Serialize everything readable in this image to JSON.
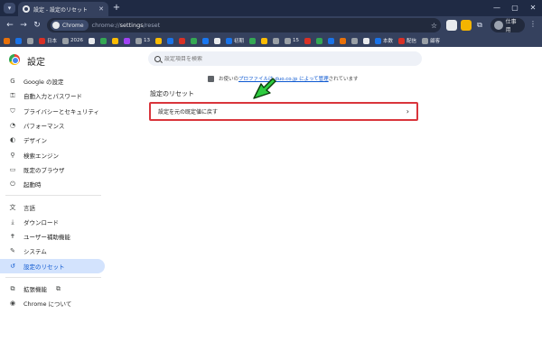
{
  "browser": {
    "tab_title": "設定 - 設定のリセット",
    "tab_close": "✕",
    "new_tab": "+",
    "omnibox": {
      "chip": "Chrome",
      "url_scheme": "chrome://",
      "url_path": "settings",
      "url_rest": "/reset"
    },
    "profile_label": "仕事用",
    "bookmarks": [
      {
        "label": "",
        "color": "#e8710a"
      },
      {
        "label": "",
        "color": "#1a73e8"
      },
      {
        "label": "",
        "color": "#9aa0a6"
      },
      {
        "label": "日本",
        "color": "#d93025"
      },
      {
        "label": "2026",
        "color": "#9aa0a6"
      },
      {
        "label": "",
        "color": "#e8eaed"
      },
      {
        "label": "",
        "color": "#34a853"
      },
      {
        "label": "",
        "color": "#fbbc04"
      },
      {
        "label": "",
        "color": "#a142f4"
      },
      {
        "label": "13",
        "color": "#9aa0a6"
      },
      {
        "label": "",
        "color": "#fbbc04"
      },
      {
        "label": "",
        "color": "#1a73e8"
      },
      {
        "label": "",
        "color": "#d93025"
      },
      {
        "label": "",
        "color": "#34a853"
      },
      {
        "label": "",
        "color": "#1877f2"
      },
      {
        "label": "",
        "color": "#e8eaed"
      },
      {
        "label": "初期",
        "color": "#1a73e8"
      },
      {
        "label": "",
        "color": "#34a853"
      },
      {
        "label": "",
        "color": "#fbbc04"
      },
      {
        "label": "",
        "color": "#9aa0a6"
      },
      {
        "label": "15",
        "color": "#9aa0a6"
      },
      {
        "label": "",
        "color": "#d93025"
      },
      {
        "label": "",
        "color": "#34a853"
      },
      {
        "label": "",
        "color": "#1a73e8"
      },
      {
        "label": "",
        "color": "#e8710a"
      },
      {
        "label": "",
        "color": "#9aa0a6"
      },
      {
        "label": "",
        "color": "#e8eaed"
      },
      {
        "label": "本数",
        "color": "#1a73e8"
      },
      {
        "label": "配信",
        "color": "#d93025"
      },
      {
        "label": "顧客",
        "color": "#9aa0a6"
      }
    ]
  },
  "settings": {
    "title": "設定",
    "search_placeholder": "設定項目を検索",
    "sidebar": [
      {
        "label": "Google の設定",
        "icon": "google-icon",
        "glyph": "G"
      },
      {
        "label": "自動入力とパスワード",
        "icon": "key-icon",
        "glyph": "⚿"
      },
      {
        "label": "プライバシーとセキュリティ",
        "icon": "shield-icon",
        "glyph": "⛉"
      },
      {
        "label": "パフォーマンス",
        "icon": "speedometer-icon",
        "glyph": "◔"
      },
      {
        "label": "デザイン",
        "icon": "palette-icon",
        "glyph": "◐"
      },
      {
        "label": "検索エンジン",
        "icon": "search-icon",
        "glyph": "⚲"
      },
      {
        "label": "既定のブラウザ",
        "icon": "browser-icon",
        "glyph": "▭"
      },
      {
        "label": "起動時",
        "icon": "power-icon",
        "glyph": "⏻"
      }
    ],
    "sidebar2": [
      {
        "label": "言語",
        "icon": "translate-icon",
        "glyph": "文"
      },
      {
        "label": "ダウンロード",
        "icon": "download-icon",
        "glyph": "⤓"
      },
      {
        "label": "ユーザー補助機能",
        "icon": "accessibility-icon",
        "glyph": "✝"
      },
      {
        "label": "システム",
        "icon": "wrench-icon",
        "glyph": "✎"
      },
      {
        "label": "設定のリセット",
        "icon": "reset-icon",
        "glyph": "↺",
        "active": true
      }
    ],
    "sidebar3": [
      {
        "label": "拡張機能",
        "icon": "puzzle-icon",
        "glyph": "⧉"
      },
      {
        "label": "Chrome について",
        "icon": "chrome-icon",
        "glyph": "◉"
      }
    ],
    "managed": {
      "prefix": "お使いの",
      "link": "プロファイルは duo.co.jp によって管理",
      "suffix": "されています"
    },
    "section_title": "設定のリセット",
    "reset_row_label": "設定を元の既定値に戻す"
  }
}
